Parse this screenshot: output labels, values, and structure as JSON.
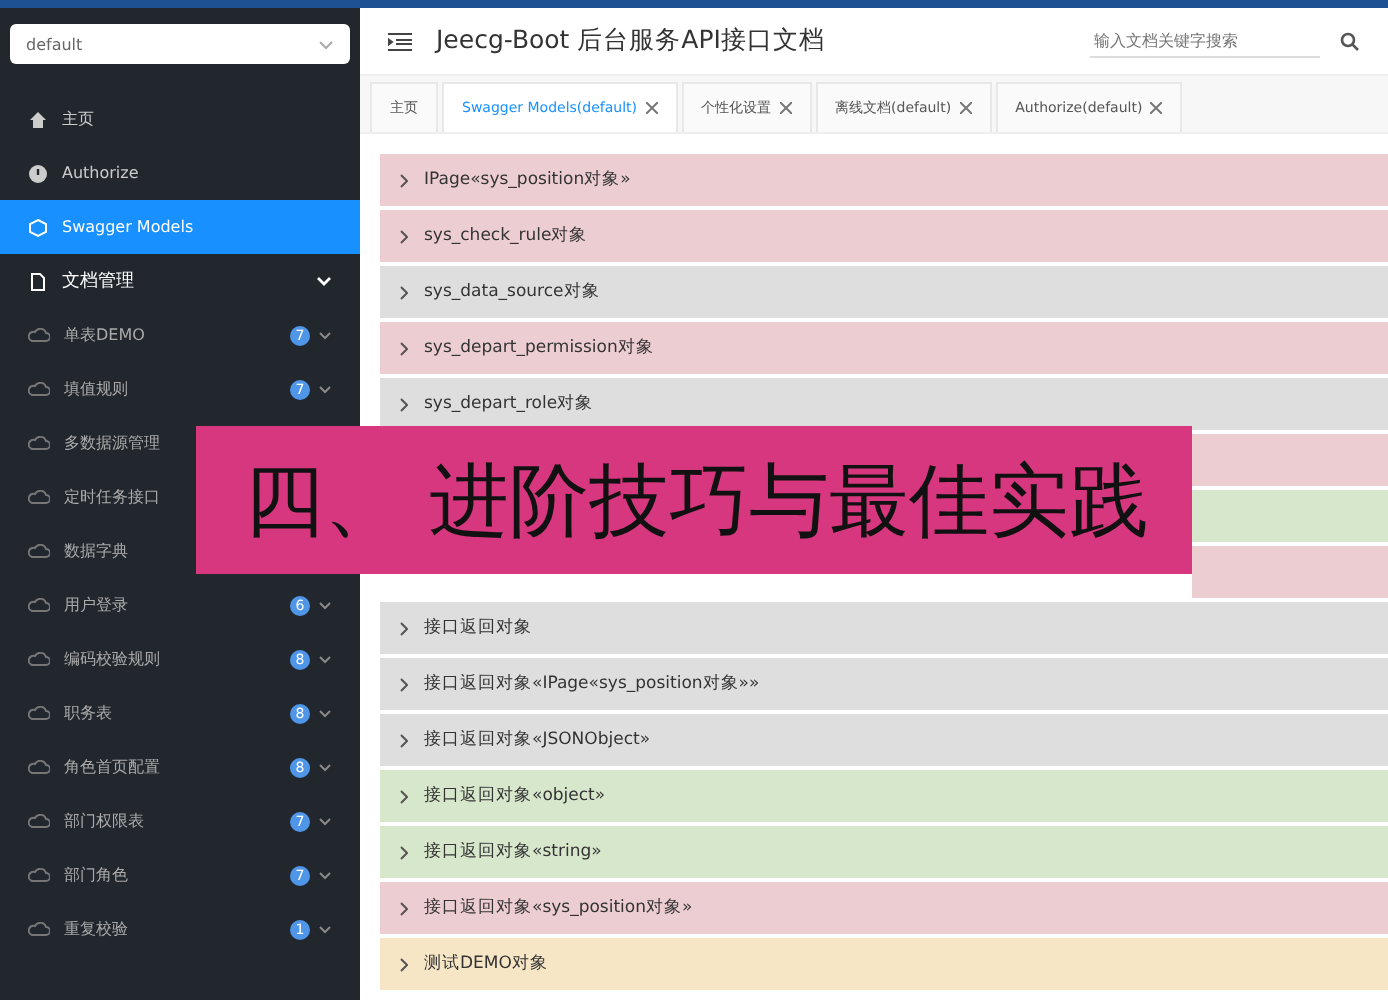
{
  "sidebar": {
    "select": {
      "value": "default"
    },
    "items": [
      {
        "label": "主页",
        "kind": "home",
        "selected": false
      },
      {
        "label": "Authorize",
        "kind": "power",
        "selected": false
      },
      {
        "label": "Swagger Models",
        "kind": "models",
        "selected": true
      },
      {
        "label": "文档管理",
        "kind": "doc",
        "selected": false,
        "expanded": true,
        "children": [
          {
            "label": "单表DEMO",
            "badge": "7"
          },
          {
            "label": "填值规则",
            "badge": "7"
          },
          {
            "label": "多数据源管理"
          },
          {
            "label": "定时任务接口"
          },
          {
            "label": "数据字典"
          },
          {
            "label": "用户登录",
            "badge": "6"
          },
          {
            "label": "编码校验规则",
            "badge": "8"
          },
          {
            "label": "职务表",
            "badge": "8"
          },
          {
            "label": "角色首页配置",
            "badge": "8"
          },
          {
            "label": "部门权限表",
            "badge": "7"
          },
          {
            "label": "部门角色",
            "badge": "7"
          },
          {
            "label": "重复校验",
            "badge": "1"
          }
        ]
      }
    ]
  },
  "header": {
    "title": "Jeecg-Boot 后台服务API接口文档",
    "search": {
      "placeholder": "输入文档关键字搜索"
    }
  },
  "tabs": [
    {
      "label": "主页",
      "selected": false,
      "closable": false
    },
    {
      "label": "Swagger Models(default)",
      "selected": true,
      "closable": true
    },
    {
      "label": "个性化设置",
      "selected": false,
      "closable": true
    },
    {
      "label": "离线文档(default)",
      "selected": false,
      "closable": true
    },
    {
      "label": "Authorize(default)",
      "selected": false,
      "closable": true
    }
  ],
  "models": [
    {
      "label": "IPage«sys_position对象»",
      "color": "#eccdd2"
    },
    {
      "label": "sys_check_rule对象",
      "color": "#eccdd2"
    },
    {
      "label": "sys_data_source对象",
      "color": "#dedede"
    },
    {
      "label": "sys_depart_permission对象",
      "color": "#eccdd2"
    },
    {
      "label": "sys_depart_role对象",
      "color": "#dedede"
    },
    {
      "color": "#eccdd2"
    },
    {
      "color": "#d7e7cc"
    },
    {
      "color": "#eccdd2"
    },
    {
      "label": "接口返回对象",
      "color": "#dedede"
    },
    {
      "label": "接口返回对象«IPage«sys_position对象»»",
      "color": "#dedede"
    },
    {
      "label": "接口返回对象«JSONObject»",
      "color": "#dedede"
    },
    {
      "label": "接口返回对象«object»",
      "color": "#d7e7cc"
    },
    {
      "label": "接口返回对象«string»",
      "color": "#d7e7cc"
    },
    {
      "label": "接口返回对象«sys_position对象»",
      "color": "#eccdd2"
    },
    {
      "label": "测试DEMO对象",
      "color": "#f7e6c6"
    }
  ],
  "banner": {
    "text": "四、 进阶技巧与最佳实践"
  }
}
